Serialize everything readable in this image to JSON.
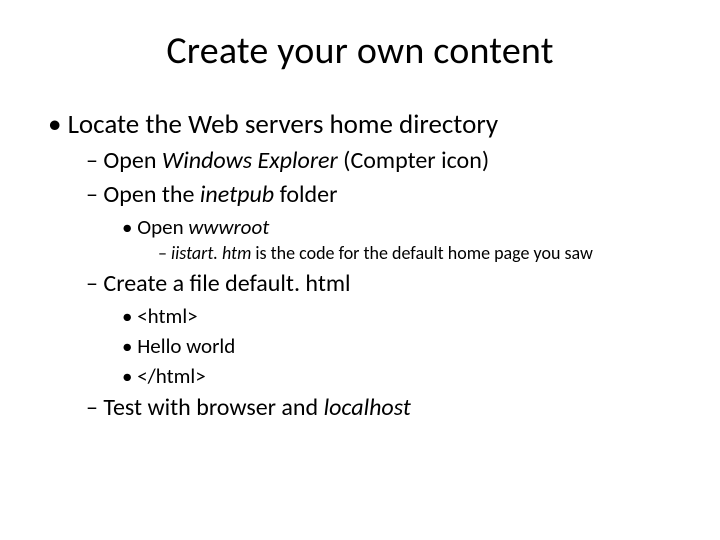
{
  "title": "Create your own content",
  "b1": "Locate the Web servers home directory",
  "b1a_pre": "Open ",
  "b1a_em": "Windows Explorer ",
  "b1a_post": "(Compter icon)",
  "b1b_pre": "Open the ",
  "b1b_em": "inetpub ",
  "b1b_post": "folder",
  "b1b1_pre": "Open ",
  "b1b1_em": "wwwroot",
  "b1b1a_em": "iistart. htm ",
  "b1b1a_post": "is the code for the default home page you saw",
  "b1c": "Create a file default. html",
  "b1c1": "<html>",
  "b1c2": "Hello world",
  "b1c3": "</html>",
  "b1d_pre": "Test with browser and ",
  "b1d_em": "localhost"
}
